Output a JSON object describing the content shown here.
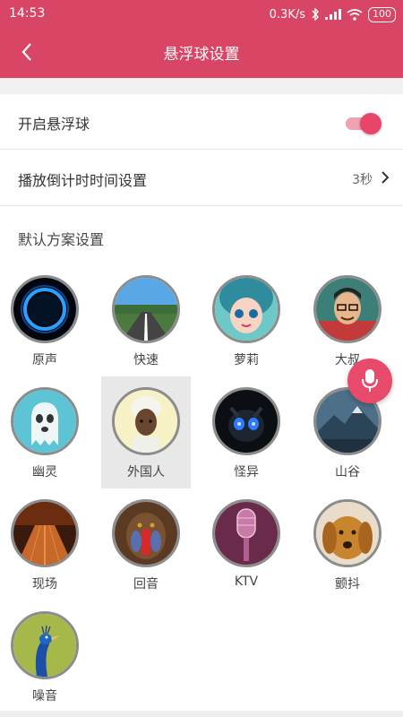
{
  "status_bar": {
    "time": "14:53",
    "network_speed": "0.3K/s",
    "battery": "100"
  },
  "header": {
    "title": "悬浮球设置",
    "back_icon": "back-arrow-icon"
  },
  "settings": {
    "float_ball_label": "开启悬浮球",
    "float_ball_enabled": true,
    "countdown_label": "播放倒计时时间设置",
    "countdown_value": "3秒"
  },
  "presets": {
    "section_title": "默认方案设置",
    "selected": "外国人",
    "items": [
      {
        "label": "原声"
      },
      {
        "label": "快速"
      },
      {
        "label": "萝莉"
      },
      {
        "label": "大叔"
      },
      {
        "label": "幽灵"
      },
      {
        "label": "外国人"
      },
      {
        "label": "怪异"
      },
      {
        "label": "山谷"
      },
      {
        "label": "现场"
      },
      {
        "label": "回音"
      },
      {
        "label": "KTV"
      },
      {
        "label": "颤抖"
      },
      {
        "label": "噪音"
      }
    ]
  },
  "colors": {
    "brand": "#d94564",
    "accent": "#e84a6b"
  }
}
